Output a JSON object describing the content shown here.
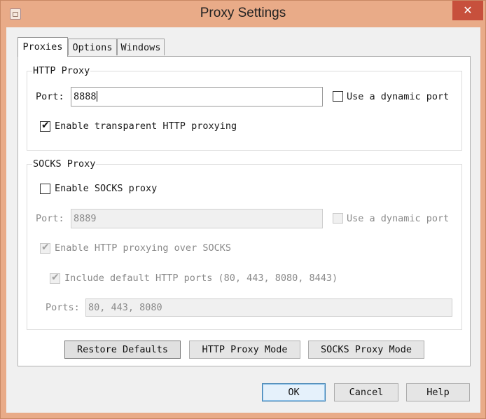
{
  "window": {
    "title": "Proxy Settings",
    "close_glyph": "✕",
    "icon": "app-icon"
  },
  "tabs": [
    {
      "label": "Proxies",
      "selected": true
    },
    {
      "label": "Options"
    },
    {
      "label": "Windows"
    }
  ],
  "http_proxy": {
    "legend": "HTTP Proxy",
    "port_label": "Port:",
    "port_value": "8888",
    "dynamic_port_label": "Use a dynamic port",
    "dynamic_port_checked": false,
    "transparent_label": "Enable transparent HTTP proxying",
    "transparent_checked": true
  },
  "socks_proxy": {
    "legend": "SOCKS Proxy",
    "enable_label": "Enable SOCKS proxy",
    "enable_checked": false,
    "port_label": "Port:",
    "port_value": "8889",
    "dynamic_port_label": "Use a dynamic port",
    "http_over_socks_label": "Enable HTTP proxying over SOCKS",
    "http_over_socks_checked": true,
    "include_ports_label": "Include default HTTP ports (80, 443, 8080, 8443)",
    "include_ports_checked": true,
    "ports_label": "Ports:",
    "ports_value": "80, 443, 8080"
  },
  "buttons": {
    "restore_defaults": "Restore Defaults",
    "http_mode": "HTTP Proxy Mode",
    "socks_mode": "SOCKS Proxy Mode",
    "ok": "OK",
    "cancel": "Cancel",
    "help": "Help"
  },
  "check_glyph": "✔",
  "colors": {
    "title_bar": "#e9ab88",
    "close_button": "#c7503c",
    "default_button_border": "#3c7fb1"
  }
}
